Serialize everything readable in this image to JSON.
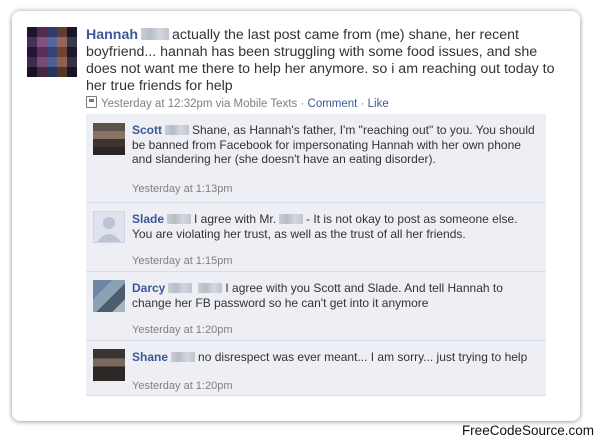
{
  "post": {
    "author": "Hannah",
    "text": "actually the last post came from (me) shane, her recent boyfriend... hannah has been struggling with some food issues, and she does not want me there to help her anymore. so i am reaching out today to her true friends for help",
    "timestamp": "Yesterday at 12:32pm via Mobile Texts",
    "separator": "·",
    "comment_link": "Comment",
    "like_link": "Like"
  },
  "comments": [
    {
      "author": "Scott",
      "text": "Shane, as Hannah's father, I'm \"reaching out\" to you. You should be banned from Facebook for impersonating Hannah with her own phone and slandering her (she doesn't have an eating disorder).",
      "time": "Yesterday at 1:13pm"
    },
    {
      "author": "Slade",
      "text_before": "I agree with Mr.",
      "text_after": "- It is not okay to post as someone else. You are violating her trust, as well as the trust of all her friends.",
      "time": "Yesterday at 1:15pm"
    },
    {
      "author": "Darcy",
      "text": "I agree with you Scott and Slade. And tell Hannah to change her FB password so he can't get into it anymore",
      "time": "Yesterday at 1:20pm"
    },
    {
      "author": "Shane",
      "text": "no disrespect was ever meant... I am sorry... just trying to help",
      "time": "Yesterday at 1:20pm"
    }
  ],
  "watermark": "FreeCodeSource.com",
  "colors": {
    "link_blue": "#3b5998",
    "comment_bg": "#edeff4",
    "meta_gray": "#808080"
  }
}
